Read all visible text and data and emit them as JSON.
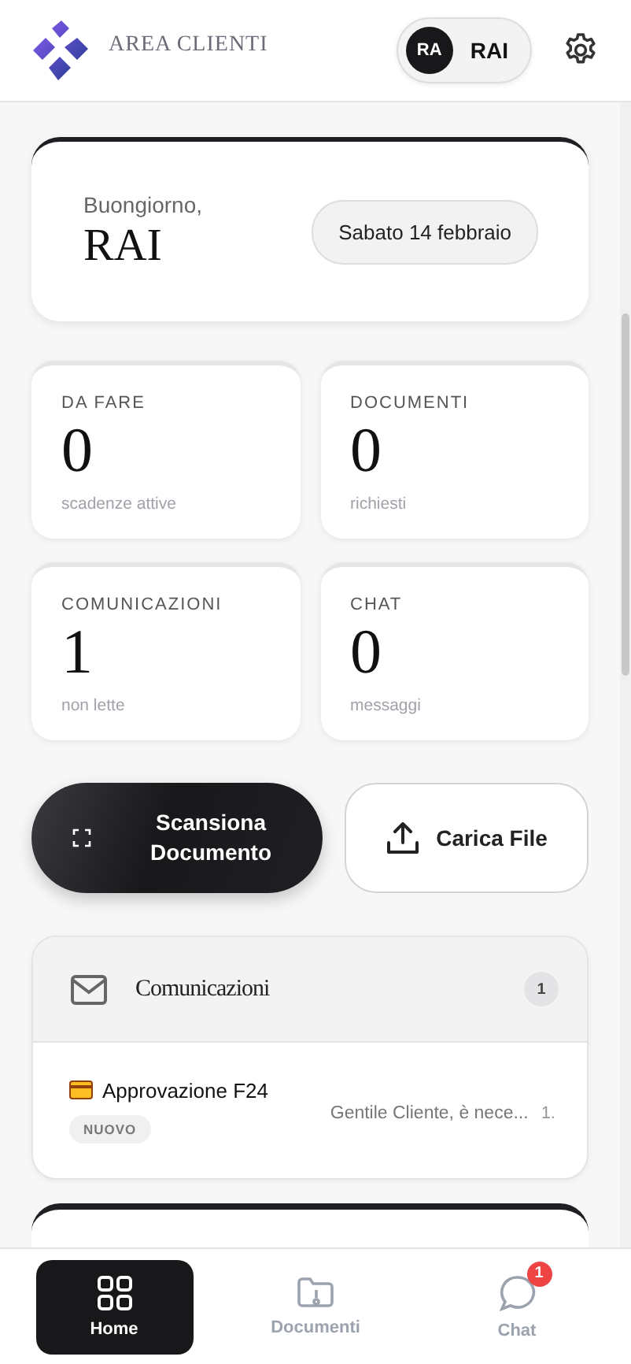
{
  "header": {
    "title": "AREA CLIENTI",
    "user": {
      "initials": "RA",
      "name": "RAI"
    }
  },
  "greeting": {
    "salutation": "Buongiorno,",
    "name": "RAI",
    "date": "Sabato 14 febbraio"
  },
  "stats": [
    {
      "label": "DA FARE",
      "value": "0",
      "caption": "scadenze attive"
    },
    {
      "label": "DOCUMENTI",
      "value": "0",
      "caption": "richiesti"
    },
    {
      "label": "COMUNICAZIONI",
      "value": "1",
      "caption": "non lette"
    },
    {
      "label": "CHAT",
      "value": "0",
      "caption": "messaggi"
    }
  ],
  "actions": [
    {
      "kind": "scan",
      "label": "Scansiona Documento"
    },
    {
      "kind": "upload",
      "label": "Carica File"
    }
  ],
  "communications": {
    "title": "Comunicazioni",
    "count": "1",
    "items": [
      {
        "title": "Approvazione F24",
        "tag": "NUOVO",
        "preview": "Gentile Cliente, è nece...",
        "date": "1."
      }
    ]
  },
  "nav": [
    {
      "kind": "home",
      "label": "Home",
      "selected": true
    },
    {
      "kind": "documents",
      "label": "Documenti",
      "selected": false
    },
    {
      "kind": "chat",
      "label": "Chat",
      "selected": false,
      "badge": "1"
    }
  ]
}
